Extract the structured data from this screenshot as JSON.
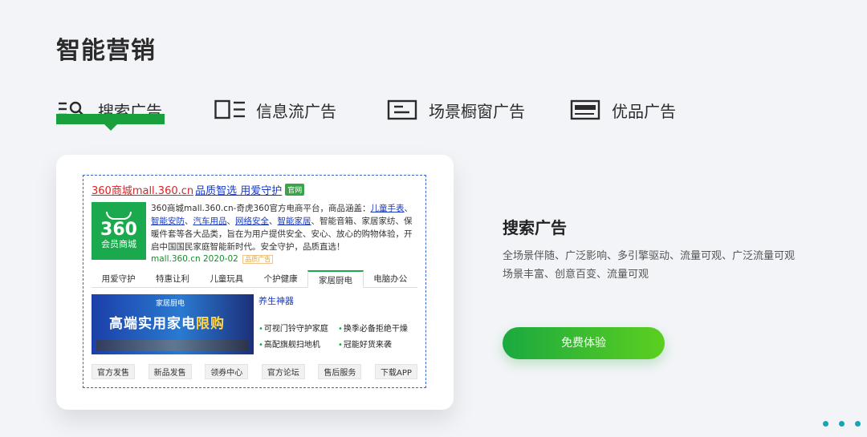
{
  "page": {
    "title": "智能营销"
  },
  "tabs": [
    {
      "label": "搜索广告",
      "icon": "search-list-icon"
    },
    {
      "label": "信息流广告",
      "icon": "feed-layout-icon"
    },
    {
      "label": "场景橱窗广告",
      "icon": "window-text-icon"
    },
    {
      "label": "优品广告",
      "icon": "banner-card-icon"
    }
  ],
  "accent_color": "#19a03c",
  "mock": {
    "title_red": "360商城mall.360.cn",
    "title_blue": "品质智选 用爱守护",
    "official_badge": "官网",
    "logo_num": "360",
    "logo_sub": "会员商城",
    "desc_prefix": "360商城mall.360.cn-奇虎360官方电商平台，商品涵盖：",
    "link1": "儿童手表",
    "sep1": "、",
    "link2": "智能安防",
    "sep2": "、",
    "link3": "汽车用品",
    "sep3": "、",
    "link4": "网络安全",
    "sep4": "、",
    "link5": "智能家居",
    "desc_suffix": "、智能音箱、家居家纺、保暖件套等各大品类，旨在为用户提供安全、安心、放心的购物体验，开启中国国民家庭智能新时代。安全守护，品质直选！",
    "meta_url": "mall.360.cn 2020-02",
    "meta_tag": "品质广告",
    "categories": [
      "用爱守护",
      "特惠让利",
      "儿童玩具",
      "个护健康",
      "家居厨电",
      "电脑办公"
    ],
    "banner_top": "家居厨电",
    "banner_main_a": "高端实用家电",
    "banner_main_b": "限购",
    "promo_title": "养生神器",
    "promo_items": [
      "可视门铃守护家庭",
      "换季必备拒绝干燥",
      "高配旗舰扫地机",
      "冠能好货来袭"
    ],
    "footer_links": [
      "官方发售",
      "新品发售",
      "领券中心",
      "官方论坛",
      "售后服务",
      "下载APP"
    ]
  },
  "detail": {
    "title": "搜索广告",
    "desc_line1": "全场景伴随、广泛影响、多引擎驱动、流量可观、广泛流量可观",
    "desc_line2": "场景丰富、创意百变、流量可观",
    "cta_label": "免费体验"
  },
  "pagination": {
    "count": 3,
    "color": "#16a3b8"
  }
}
